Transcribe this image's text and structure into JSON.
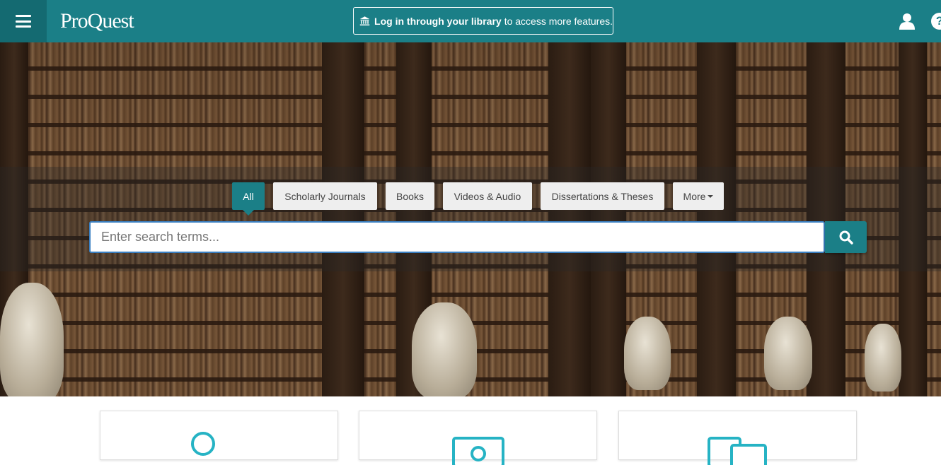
{
  "header": {
    "brand": "ProQuest",
    "login_bold": "Log in through your library",
    "login_rest": "to access more features.",
    "help_glyph": "?",
    "background_color": "#1b7f87"
  },
  "icons": {
    "menu": "hamburger-icon",
    "library": "library-icon",
    "user": "user-icon",
    "help": "help-icon",
    "search": "search-icon"
  },
  "search": {
    "tabs": [
      {
        "label": "All",
        "active": true
      },
      {
        "label": "Scholarly Journals",
        "active": false
      },
      {
        "label": "Books",
        "active": false
      },
      {
        "label": "Videos & Audio",
        "active": false
      },
      {
        "label": "Dissertations & Theses",
        "active": false
      },
      {
        "label": "More",
        "active": false
      }
    ],
    "placeholder": "Enter search terms...",
    "value": ""
  },
  "cards": [
    {
      "icon": "magnifier-icon"
    },
    {
      "icon": "image-icon"
    },
    {
      "icon": "documents-icon"
    }
  ],
  "accent_color": "#1b7f87",
  "card_icon_color": "#26b3c4"
}
